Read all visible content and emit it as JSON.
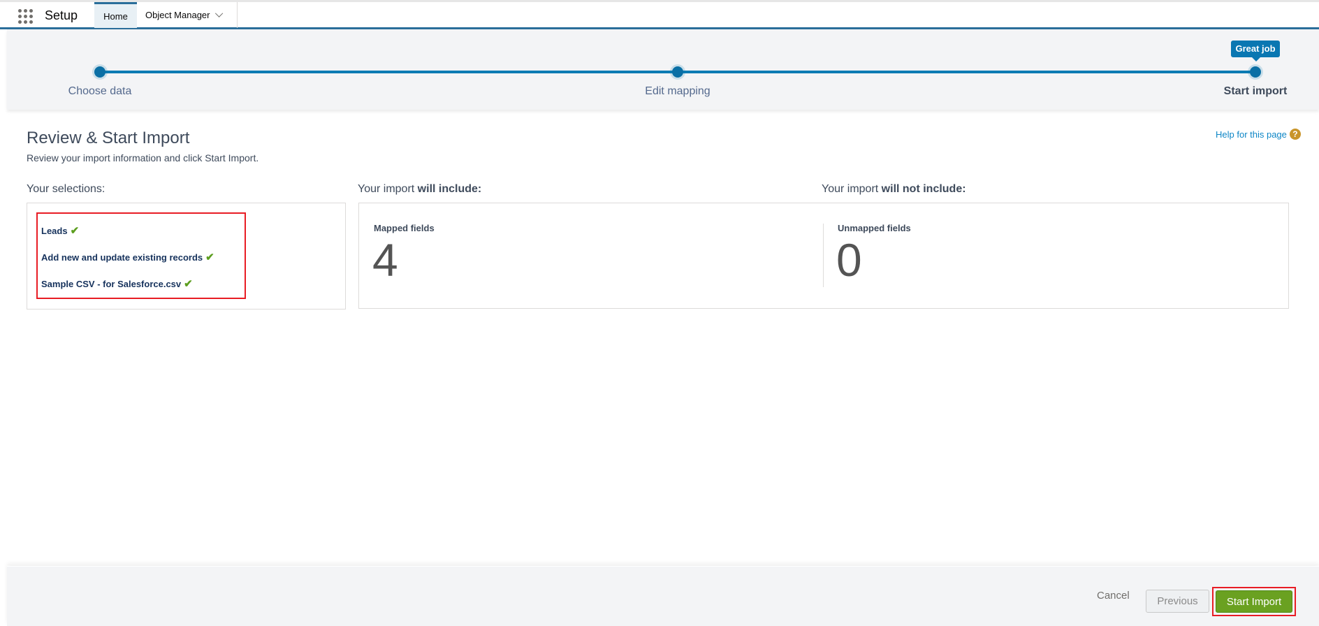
{
  "header": {
    "app_name": "Setup",
    "tabs": [
      {
        "label": "Home",
        "active": true
      },
      {
        "label": "Object Manager",
        "has_dropdown": true
      }
    ]
  },
  "progress": {
    "steps": [
      {
        "label": "Choose data",
        "state": "complete"
      },
      {
        "label": "Edit mapping",
        "state": "complete"
      },
      {
        "label": "Start import",
        "state": "current"
      }
    ],
    "tooltip": "Great job",
    "accent_color": "#0c7bb3"
  },
  "page": {
    "title": "Review & Start Import",
    "subtitle": "Review your import information and click Start Import.",
    "help_link": "Help for this page",
    "help_icon": "question-icon"
  },
  "selections": {
    "label": "Your selections:",
    "items": [
      {
        "text": "Leads",
        "icon": "checkmark-icon"
      },
      {
        "text": "Add new and update existing records",
        "icon": "checkmark-icon"
      },
      {
        "text": "Sample CSV - for Salesforce.csv",
        "icon": "checkmark-icon"
      }
    ]
  },
  "include": {
    "label_prefix": "Your import ",
    "label_bold": "will include:",
    "field_label": "Mapped fields",
    "count": "4"
  },
  "exclude": {
    "label_prefix": "Your import ",
    "label_bold": "will not include:",
    "field_label": "Unmapped fields",
    "count": "0"
  },
  "footer": {
    "cancel_label": "Cancel",
    "previous_label": "Previous",
    "start_label": "Start Import",
    "start_color": "#6aa121"
  }
}
